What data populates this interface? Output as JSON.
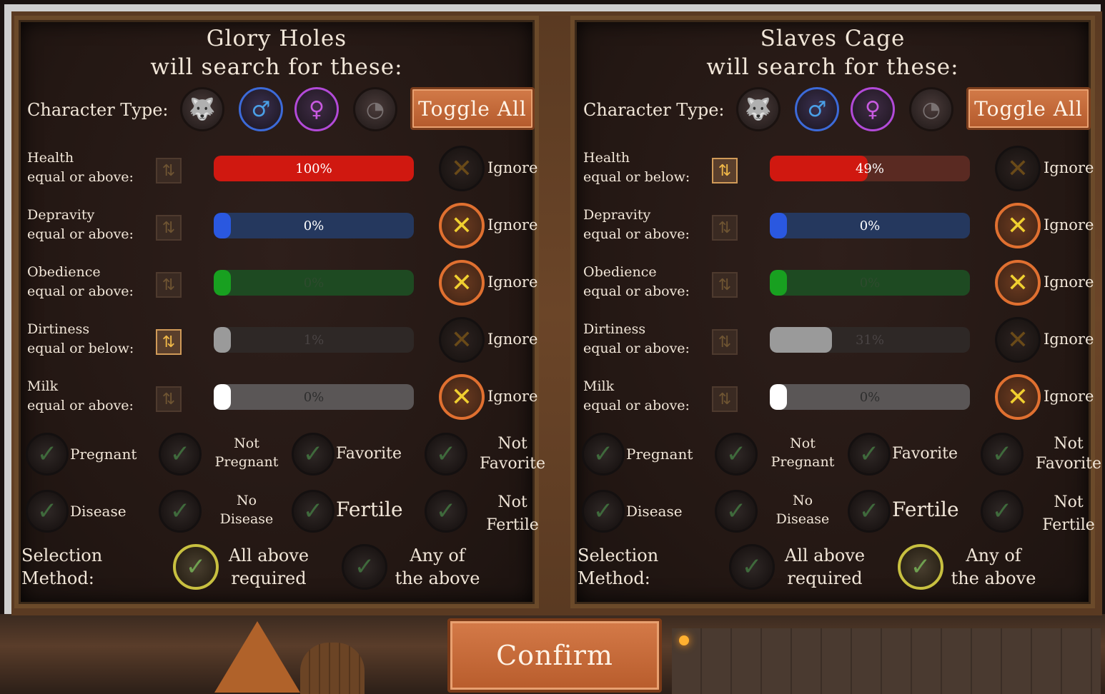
{
  "confirm_label": "Confirm",
  "character_type_label": "Character Type:",
  "toggle_all_label": "Toggle All",
  "ignore_label": "Ignore",
  "selection_method_label_1": "Selection",
  "selection_method_label_2": "Method:",
  "panels": [
    {
      "title_line1": "Glory Holes",
      "title_line2": "will search for these:",
      "character_types": [
        {
          "icon": "beast-icon",
          "active": false
        },
        {
          "icon": "male-icon",
          "active": true
        },
        {
          "icon": "female-icon",
          "active": true
        },
        {
          "icon": "fetus-icon",
          "active": false
        }
      ],
      "stats": [
        {
          "name": "Health",
          "condition": "equal or above:",
          "value": "100%",
          "fill": 1.0,
          "color": "#d01810",
          "swap_active": false,
          "ignore": false
        },
        {
          "name": "Depravity",
          "condition": "equal or above:",
          "value": "0%",
          "fill": 0.0,
          "color": "#2a58e0",
          "swap_active": false,
          "ignore": true
        },
        {
          "name": "Obedience",
          "condition": "equal or above:",
          "value": "0%",
          "fill": 0.0,
          "color": "#18a020",
          "swap_active": false,
          "ignore": true
        },
        {
          "name": "Dirtiness",
          "condition": "equal or below:",
          "value": "1%",
          "fill": 0.01,
          "color": "#9a9a9a",
          "swap_active": true,
          "ignore": false
        },
        {
          "name": "Milk",
          "condition": "equal or above:",
          "value": "0%",
          "fill": 0.0,
          "color": "#ffffff",
          "swap_active": false,
          "ignore": true
        }
      ],
      "filters": [
        {
          "l1": "Pregnant",
          "l2": ""
        },
        {
          "l1": "Not",
          "l2": "Pregnant"
        },
        {
          "l1": "Favorite",
          "l2": ""
        },
        {
          "l1": "Not",
          "l2": "Favorite"
        },
        {
          "l1": "Disease",
          "l2": ""
        },
        {
          "l1": "No",
          "l2": "Disease"
        },
        {
          "l1": "Fertile",
          "l2": ""
        },
        {
          "l1": "Not",
          "l2": "Fertile"
        }
      ],
      "method_all_l1": "All above",
      "method_all_l2": "required",
      "method_any_l1": "Any of",
      "method_any_l2": "the above",
      "method_selected": "all"
    },
    {
      "title_line1": "Slaves Cage",
      "title_line2": "will search for these:",
      "character_types": [
        {
          "icon": "beast-icon",
          "active": false
        },
        {
          "icon": "male-icon",
          "active": true
        },
        {
          "icon": "female-icon",
          "active": true
        },
        {
          "icon": "fetus-icon",
          "active": false
        }
      ],
      "stats": [
        {
          "name": "Health",
          "condition": "equal or below:",
          "value": "49%",
          "fill": 0.49,
          "color": "#d01810",
          "swap_active": true,
          "ignore": false
        },
        {
          "name": "Depravity",
          "condition": "equal or above:",
          "value": "0%",
          "fill": 0.0,
          "color": "#2a58e0",
          "swap_active": false,
          "ignore": true
        },
        {
          "name": "Obedience",
          "condition": "equal or above:",
          "value": "0%",
          "fill": 0.0,
          "color": "#18a020",
          "swap_active": false,
          "ignore": true
        },
        {
          "name": "Dirtiness",
          "condition": "equal or above:",
          "value": "31%",
          "fill": 0.31,
          "color": "#9a9a9a",
          "swap_active": false,
          "ignore": false
        },
        {
          "name": "Milk",
          "condition": "equal or above:",
          "value": "0%",
          "fill": 0.0,
          "color": "#ffffff",
          "swap_active": false,
          "ignore": true
        }
      ],
      "filters": [
        {
          "l1": "Pregnant",
          "l2": ""
        },
        {
          "l1": "Not",
          "l2": "Pregnant"
        },
        {
          "l1": "Favorite",
          "l2": ""
        },
        {
          "l1": "Not",
          "l2": "Favorite"
        },
        {
          "l1": "Disease",
          "l2": ""
        },
        {
          "l1": "No",
          "l2": "Disease"
        },
        {
          "l1": "Fertile",
          "l2": ""
        },
        {
          "l1": "Not",
          "l2": "Fertile"
        }
      ],
      "method_all_l1": "All above",
      "method_all_l2": "required",
      "method_any_l1": "Any of",
      "method_any_l2": "the above",
      "method_selected": "any"
    }
  ]
}
